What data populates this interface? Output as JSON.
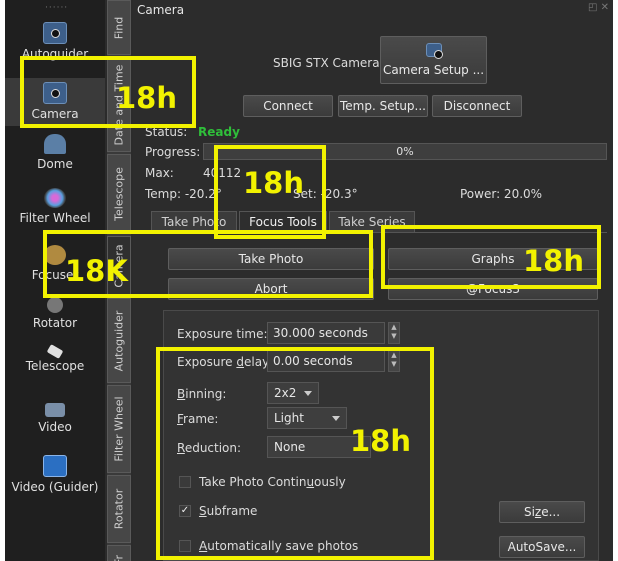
{
  "iconbar": {
    "items": [
      {
        "label": "Autoguider",
        "icon": "camera-icon"
      },
      {
        "label": "Camera",
        "icon": "camera-icon"
      },
      {
        "label": "Dome",
        "icon": "dome-icon"
      },
      {
        "label": "Filter Wheel",
        "icon": "filter-wheel-icon"
      },
      {
        "label": "Focuser",
        "icon": "focuser-icon"
      },
      {
        "label": "Rotator",
        "icon": "rotator-icon"
      },
      {
        "label": "Telescope",
        "icon": "telescope-icon"
      },
      {
        "label": "Video",
        "icon": "video-icon"
      },
      {
        "label": "Video (Guider)",
        "icon": "video-guider-icon"
      }
    ]
  },
  "vtabs": [
    "Find",
    "Date and Time",
    "Telescope",
    "Camera",
    "Autoguider",
    "Filter Wheel",
    "Rotator",
    "Fr"
  ],
  "camera": {
    "title": "Camera",
    "model": "SBIG STX Cameras",
    "setup_label": "Camera Setup ...",
    "connect": "Connect",
    "temp_setup": "Temp. Setup...",
    "disconnect": "Disconnect",
    "status_label": "Status:",
    "status_value": "Ready",
    "progress_label": "Progress:",
    "progress_value": "0%",
    "progress_fraction": 0,
    "max_label": "Max:",
    "max_value": "40112",
    "temp_label": "Temp: -20.2°",
    "set_label": "Set: -20.3°",
    "power_label": "Power: 20.0%"
  },
  "tabs": [
    "Take Photo",
    "Focus Tools",
    "Take Series"
  ],
  "actions": {
    "take_photo": "Take Photo",
    "graphs": "Graphs",
    "abort": "Abort",
    "focus": "@Focus3"
  },
  "settings": {
    "exposure_time_label": "Exposure time:",
    "exposure_time_value": "30.000 seconds",
    "exposure_delay_label": "Exposure delay:",
    "exposure_delay_value": "0.00 seconds",
    "binning_label": "Binning:",
    "binning_value": "2x2",
    "frame_label": "Frame:",
    "frame_value": "Light",
    "reduction_label": "Reduction:",
    "reduction_value": "None",
    "take_continuously": "Take Photo Continuously",
    "subframe": "Subframe",
    "auto_save": "Automatically save photos",
    "size_button": "Size...",
    "autosave_button": "AutoSave..."
  },
  "annotations": [
    "18h",
    "18h",
    "18K",
    "18h",
    "18h"
  ],
  "colors": {
    "highlight": "#f2f200",
    "ready": "#2fbf3a"
  }
}
